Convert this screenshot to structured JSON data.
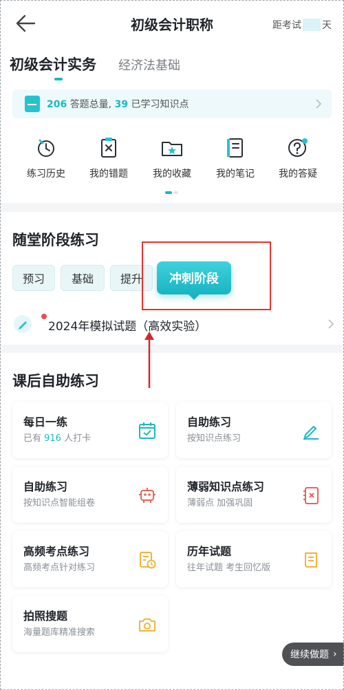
{
  "nav": {
    "title": "初级会计职称",
    "countdown_prefix": "距考试",
    "countdown_suffix": "天"
  },
  "subject_tabs": [
    {
      "label": "初级会计实务",
      "active": true
    },
    {
      "label": "经济法基础",
      "active": false
    }
  ],
  "stats": {
    "questions_total": "206",
    "questions_label": "答题总量,",
    "knowledge_points": "39",
    "knowledge_label": "已学习知识点"
  },
  "shortcuts": [
    {
      "label": "练习历史",
      "icon": "history-icon"
    },
    {
      "label": "我的错题",
      "icon": "wrong-questions-icon"
    },
    {
      "label": "我的收藏",
      "icon": "favorites-folder-icon"
    },
    {
      "label": "我的笔记",
      "icon": "notes-icon"
    },
    {
      "label": "我的答疑",
      "icon": "question-answer-icon"
    }
  ],
  "stage_section": {
    "title": "随堂阶段练习",
    "stages": [
      {
        "label": "预习",
        "active": false
      },
      {
        "label": "基础",
        "active": false
      },
      {
        "label": "提升",
        "active": false
      },
      {
        "label": "冲刺阶段",
        "active": true
      }
    ],
    "exam_item": "2024年模拟试题（高效实验）"
  },
  "self_section": {
    "title": "课后自助练习",
    "cards": [
      {
        "title": "每日一练",
        "sub_prefix": "已有 ",
        "sub_num": "916",
        "sub_suffix": " 人打卡",
        "icon": "calendar-check-icon"
      },
      {
        "title": "自助练习",
        "subtitle": "按知识点练习",
        "icon": "pencil-icon"
      },
      {
        "title": "自助练习",
        "subtitle": "按知识点智能组卷",
        "icon": "robot-icon"
      },
      {
        "title": "薄弱知识点练习",
        "subtitle": "薄弱点  加强巩固",
        "icon": "weak-book-icon"
      },
      {
        "title": "高频考点练习",
        "subtitle": "高频考点针对练习",
        "icon": "clock-doc-icon"
      },
      {
        "title": "历年试题",
        "subtitle": "往年试题  考生回忆版",
        "icon": "scroll-doc-icon"
      },
      {
        "title": "拍照搜题",
        "subtitle": "海量题库精准搜索",
        "icon": "camera-icon"
      }
    ]
  },
  "continue_button": "继续做题",
  "colors": {
    "accent": "#19b7c3",
    "annotation_red": "#e5322d",
    "icon_yellow": "#f0b43a",
    "icon_red": "#e8635a"
  }
}
